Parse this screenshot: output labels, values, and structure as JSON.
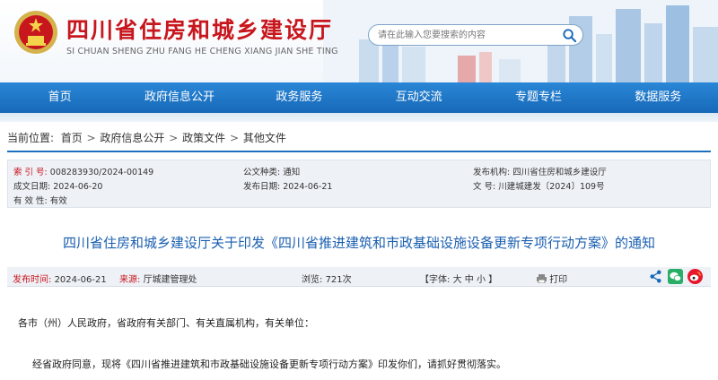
{
  "header": {
    "title": "四川省住房和城乡建设厅",
    "subtitle": "SI CHUAN SHENG ZHU FANG HE CHENG XIANG JIAN SHE TING",
    "search_placeholder": "请在此输入您要搜索的内容",
    "colors": {
      "title": "#c8161d",
      "nav": "#1769b8"
    }
  },
  "nav": {
    "items": [
      "首页",
      "政府信息公开",
      "政务服务",
      "互动交流",
      "专题专栏",
      "数据服务"
    ]
  },
  "breadcrumb": {
    "label": "当前位置:",
    "items": [
      "首页",
      "政府信息公开",
      "政策文件",
      "其他文件"
    ],
    "separator": ">"
  },
  "meta": {
    "index_label": "索 引 号:",
    "index_value": "008283930/2024-00149",
    "category_label": "公文种类:",
    "category_value": "通知",
    "issuer_label": "发布机构:",
    "issuer_value": "四川省住房和城乡建设厅",
    "created_label": "成文日期:",
    "created_value": "2024-06-20",
    "published_label": "发布日期:",
    "published_value": "2024-06-21",
    "docno_label": "文  号:",
    "docno_value": "川建城建发〔2024〕109号",
    "validity_label": "有 效 性:",
    "validity_value": "有效"
  },
  "article": {
    "title": "四川省住房和城乡建设厅关于印发《四川省推进建筑和市政基础设施设备更新专项行动方案》的通知",
    "info": {
      "time_label": "发布时间:",
      "time_value": "2024-06-21",
      "source_label": "来源:",
      "source_value": "厅城建管理处",
      "views_label": "浏览:",
      "views_value": "721次",
      "font_label": "【字体:",
      "font_large": "大",
      "font_medium": "中",
      "font_small": "小",
      "font_close": "】",
      "print_label": "打印"
    },
    "share_icons": [
      "share-icon",
      "wechat-icon",
      "weibo-icon"
    ],
    "paragraphs": [
      "各市（州）人民政府，省政府有关部门、有关直属机构，有关单位：",
      "经省政府同意，现将《四川省推进建筑和市政基础设施设备更新专项行动方案》印发你们，请抓好贯彻落实。"
    ]
  }
}
